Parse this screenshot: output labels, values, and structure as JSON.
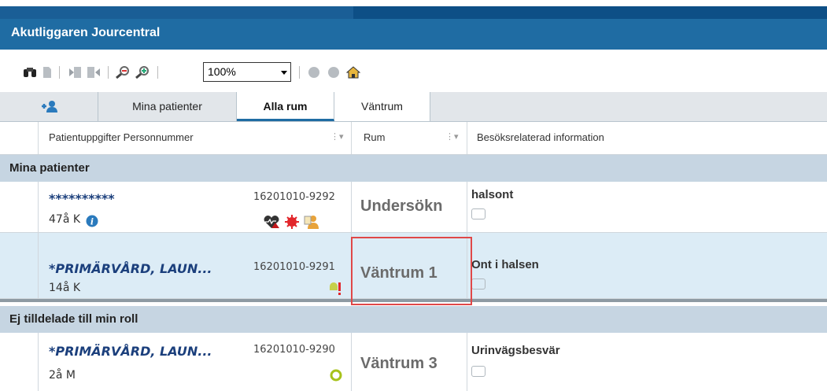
{
  "app": {
    "title": "Akutliggaren Jourcentral"
  },
  "toolbar": {
    "zoom_value": "100%"
  },
  "tabs": [
    {
      "label": "Mina patienter"
    },
    {
      "label": "Alla rum"
    },
    {
      "label": "Väntrum"
    }
  ],
  "columns": {
    "patient": "Patientuppgifter  Personnummer",
    "room": "Rum",
    "info": "Besöksrelaterad information"
  },
  "groups": {
    "mine": "Mina patienter",
    "unassigned": "Ej tilldelade till min roll"
  },
  "rows": [
    {
      "name": "**********",
      "age": "47å K",
      "pnr": "16201010-9292",
      "room": "Undersökn",
      "info": "halsont"
    },
    {
      "name": "*PRIMÄRVÅRD, LAUN...",
      "age": "14å K",
      "pnr": "16201010-9291",
      "room": "Väntrum 1",
      "info": "Ont i halsen"
    },
    {
      "name": "*PRIMÄRVÅRD, LAUN...",
      "age": "2å M",
      "pnr": "16201010-9290",
      "room": "Väntrum 3",
      "info": "Urinvägsbesvär"
    }
  ],
  "colors": {
    "accent": "#1f6ca3",
    "group_bg": "#c6d5e2",
    "selected_row": "#dcecf6",
    "highlight": "#e04848"
  }
}
